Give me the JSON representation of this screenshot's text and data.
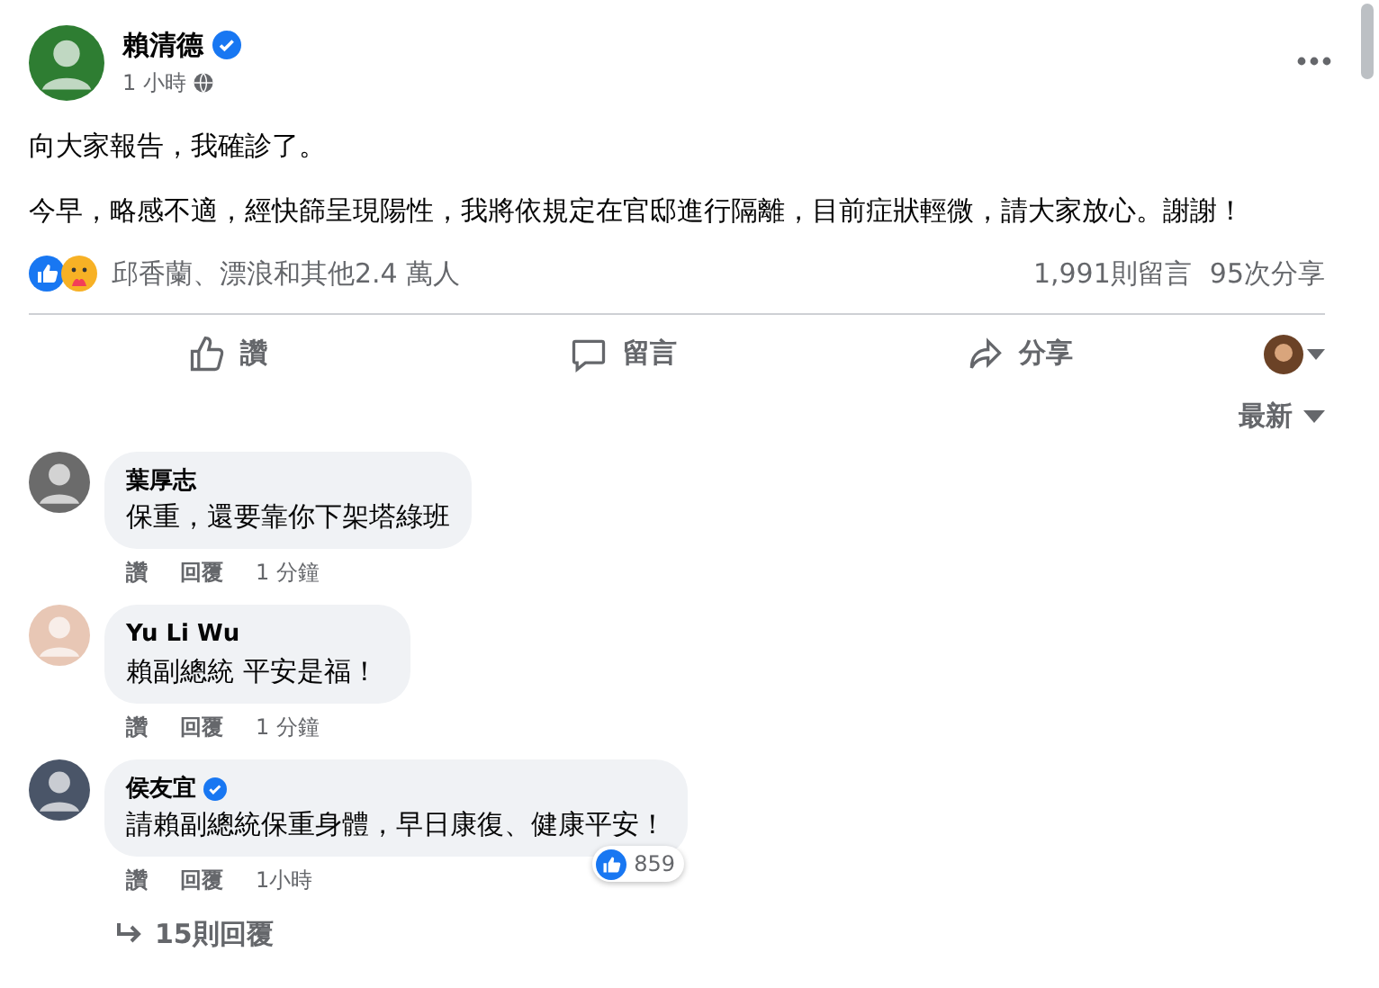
{
  "post": {
    "author": "賴清德",
    "verified": true,
    "time": "1 小時",
    "paragraphs": [
      "向大家報告，我確診了。",
      "今早，略感不適，經快篩呈現陽性，我將依規定在官邸進行隔離，目前症狀輕微，請大家放心。謝謝！"
    ],
    "reactions_text": "邱香蘭、漂浪和其他2.4 萬人",
    "comments_count": "1,991則留言",
    "shares_count": "95次分享"
  },
  "actions": [
    "讚",
    "留言",
    "分享"
  ],
  "sort": "最新",
  "comments": [
    {
      "author": "葉厚志",
      "verified": false,
      "text": "保重，還要靠你下架塔綠班",
      "like": "讚",
      "reply": "回覆",
      "time": "1 分鐘"
    },
    {
      "author": "Yu Li Wu",
      "verified": false,
      "text": "賴副總統 平安是福！",
      "like": "讚",
      "reply": "回覆",
      "time": "1 分鐘"
    },
    {
      "author": "侯友宜",
      "verified": true,
      "text": "請賴副總統保重身體，早日康復、健康平安！",
      "like": "讚",
      "reply": "回覆",
      "time": "1小時",
      "reaction_count": "859",
      "replies": "15則回覆"
    }
  ]
}
